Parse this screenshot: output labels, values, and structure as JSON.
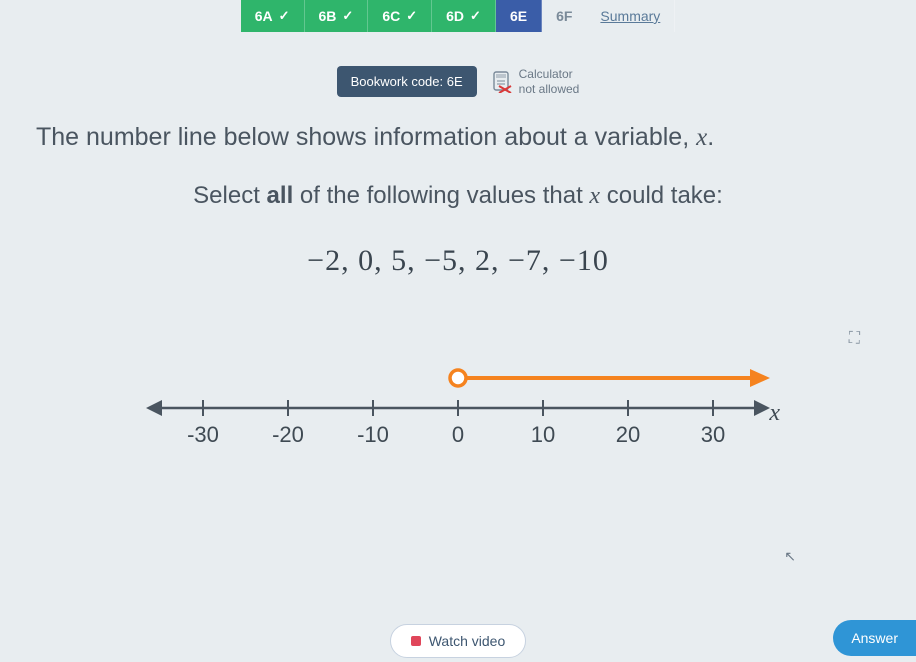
{
  "tabs": {
    "t6A": "6A",
    "t6B": "6B",
    "t6C": "6C",
    "t6D": "6D",
    "t6E": "6E",
    "t6F": "6F",
    "summary": "Summary"
  },
  "bookwork": "Bookwork code: 6E",
  "calc": {
    "l1": "Calculator",
    "l2": "not allowed"
  },
  "question": {
    "line1a": "The number line below shows information about a variable, ",
    "line1var": "x",
    "line1b": ".",
    "line2a": "Select ",
    "line2b": "all",
    "line2c": " of the following values that ",
    "line2var": "x",
    "line2d": " could take:"
  },
  "values_text": "−2,   0,   5,  −5,   2,  −7,  −10",
  "numberline": {
    "ticks": [
      "-30",
      "-20",
      "-10",
      "0",
      "10",
      "20",
      "30"
    ],
    "var": "x",
    "open_at": 0,
    "direction": "right"
  },
  "watch": "Watch video",
  "answer": "Answer",
  "chart_data": {
    "type": "numberline",
    "axis_min": -30,
    "axis_max": 30,
    "tick_step": 10,
    "interval": {
      "lower": 0,
      "lower_open": true,
      "upper": null,
      "arrow_right": true
    },
    "candidate_values": [
      -2,
      0,
      5,
      -5,
      2,
      -7,
      -10
    ]
  }
}
